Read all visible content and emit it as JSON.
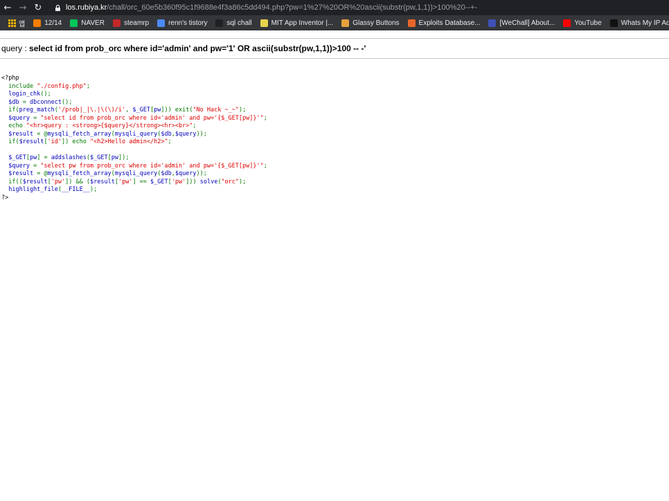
{
  "browser": {
    "url_host": "los.rubiya.kr",
    "url_path": "/chall/orc_60e5b360f95c1f9688e4f3a86c5dd494.php?pw=1%27%20OR%20ascii(substr(pw,1,1))>100%20--+-"
  },
  "bookmarks": [
    {
      "label": "앱",
      "icon": "apps-icon"
    },
    {
      "label": "12/14",
      "icon": "blogger-icon",
      "color": "#f57d00"
    },
    {
      "label": "NAVER",
      "icon": "naver-icon",
      "color": "#03c75a"
    },
    {
      "label": "steamrp",
      "icon": "steamrp-icon",
      "color": "#c62828"
    },
    {
      "label": "renn's tistory",
      "icon": "tistory-icon",
      "color": "#4c8bf5"
    },
    {
      "label": "sql chall",
      "icon": "z-icon",
      "color": "#202124"
    },
    {
      "label": "MIT App Inventor |...",
      "icon": "mit-icon",
      "color": "#e8d44d"
    },
    {
      "label": "Glassy Buttons",
      "icon": "glassy-icon",
      "color": "#e6a23c"
    },
    {
      "label": "Exploits Database...",
      "icon": "exploitdb-icon",
      "color": "#e8662a"
    },
    {
      "label": "[WeChall] About...",
      "icon": "wechall-icon",
      "color": "#3f51b5"
    },
    {
      "label": "YouTube",
      "icon": "youtube-icon",
      "color": "#ff0000"
    },
    {
      "label": "Whats My IP Ad",
      "icon": "whatsmyip-icon",
      "color": "#111111"
    }
  ],
  "page": {
    "query_prefix": "query : ",
    "query_sql": "select id from prob_orc where id='admin' and pw='1' OR ascii(substr(pw,1,1))>100 -- -'",
    "code_lines": [
      [
        {
          "t": "tag",
          "v": "<?php"
        }
      ],
      [
        {
          "t": "default",
          "v": "  "
        },
        {
          "t": "keyword",
          "v": "include "
        },
        {
          "t": "string",
          "v": "\"./config.php\""
        },
        {
          "t": "keyword",
          "v": ";"
        }
      ],
      [
        {
          "t": "default",
          "v": "  login_chk"
        },
        {
          "t": "keyword",
          "v": "();"
        }
      ],
      [
        {
          "t": "default",
          "v": "  $db "
        },
        {
          "t": "keyword",
          "v": "= "
        },
        {
          "t": "default",
          "v": "dbconnect"
        },
        {
          "t": "keyword",
          "v": "();"
        }
      ],
      [
        {
          "t": "default",
          "v": "  "
        },
        {
          "t": "keyword",
          "v": "if("
        },
        {
          "t": "default",
          "v": "preg_match"
        },
        {
          "t": "keyword",
          "v": "("
        },
        {
          "t": "string",
          "v": "'/prob|_|\\.|\\(\\)/i'"
        },
        {
          "t": "keyword",
          "v": ", "
        },
        {
          "t": "default",
          "v": "$_GET"
        },
        {
          "t": "keyword",
          "v": "["
        },
        {
          "t": "default",
          "v": "pw"
        },
        {
          "t": "keyword",
          "v": "])) exit("
        },
        {
          "t": "string",
          "v": "\"No Hack ~_~\""
        },
        {
          "t": "keyword",
          "v": ");"
        }
      ],
      [
        {
          "t": "default",
          "v": "  $query "
        },
        {
          "t": "keyword",
          "v": "= "
        },
        {
          "t": "string",
          "v": "\"select id from prob_orc where id='admin' and pw='{$_GET[pw]}'\""
        },
        {
          "t": "keyword",
          "v": ";"
        }
      ],
      [
        {
          "t": "default",
          "v": "  "
        },
        {
          "t": "keyword",
          "v": "echo "
        },
        {
          "t": "string",
          "v": "\"<hr>query : <strong>{$query}</strong><hr><br>\""
        },
        {
          "t": "keyword",
          "v": ";"
        }
      ],
      [
        {
          "t": "default",
          "v": "  $result "
        },
        {
          "t": "keyword",
          "v": "= @"
        },
        {
          "t": "default",
          "v": "mysqli_fetch_array"
        },
        {
          "t": "keyword",
          "v": "("
        },
        {
          "t": "default",
          "v": "mysqli_query"
        },
        {
          "t": "keyword",
          "v": "("
        },
        {
          "t": "default",
          "v": "$db"
        },
        {
          "t": "keyword",
          "v": ","
        },
        {
          "t": "default",
          "v": "$query"
        },
        {
          "t": "keyword",
          "v": "));"
        }
      ],
      [
        {
          "t": "default",
          "v": "  "
        },
        {
          "t": "keyword",
          "v": "if("
        },
        {
          "t": "default",
          "v": "$result"
        },
        {
          "t": "keyword",
          "v": "["
        },
        {
          "t": "string",
          "v": "'id'"
        },
        {
          "t": "keyword",
          "v": "]) echo "
        },
        {
          "t": "string",
          "v": "\"<h2>Hello admin</h2>\""
        },
        {
          "t": "keyword",
          "v": ";"
        }
      ],
      [
        {
          "t": "default",
          "v": ""
        }
      ],
      [
        {
          "t": "default",
          "v": "  $_GET"
        },
        {
          "t": "keyword",
          "v": "["
        },
        {
          "t": "default",
          "v": "pw"
        },
        {
          "t": "keyword",
          "v": "] = "
        },
        {
          "t": "default",
          "v": "addslashes"
        },
        {
          "t": "keyword",
          "v": "("
        },
        {
          "t": "default",
          "v": "$_GET"
        },
        {
          "t": "keyword",
          "v": "["
        },
        {
          "t": "default",
          "v": "pw"
        },
        {
          "t": "keyword",
          "v": "]);"
        }
      ],
      [
        {
          "t": "default",
          "v": "  $query "
        },
        {
          "t": "keyword",
          "v": "= "
        },
        {
          "t": "string",
          "v": "\"select pw from prob_orc where id='admin' and pw='{$_GET[pw]}'\""
        },
        {
          "t": "keyword",
          "v": ";"
        }
      ],
      [
        {
          "t": "default",
          "v": "  $result "
        },
        {
          "t": "keyword",
          "v": "= @"
        },
        {
          "t": "default",
          "v": "mysqli_fetch_array"
        },
        {
          "t": "keyword",
          "v": "("
        },
        {
          "t": "default",
          "v": "mysqli_query"
        },
        {
          "t": "keyword",
          "v": "("
        },
        {
          "t": "default",
          "v": "$db"
        },
        {
          "t": "keyword",
          "v": ","
        },
        {
          "t": "default",
          "v": "$query"
        },
        {
          "t": "keyword",
          "v": "));"
        }
      ],
      [
        {
          "t": "default",
          "v": "  "
        },
        {
          "t": "keyword",
          "v": "if(("
        },
        {
          "t": "default",
          "v": "$result"
        },
        {
          "t": "keyword",
          "v": "["
        },
        {
          "t": "string",
          "v": "'pw'"
        },
        {
          "t": "keyword",
          "v": "]) && ("
        },
        {
          "t": "default",
          "v": "$result"
        },
        {
          "t": "keyword",
          "v": "["
        },
        {
          "t": "string",
          "v": "'pw'"
        },
        {
          "t": "keyword",
          "v": "] == "
        },
        {
          "t": "default",
          "v": "$_GET"
        },
        {
          "t": "keyword",
          "v": "["
        },
        {
          "t": "string",
          "v": "'pw'"
        },
        {
          "t": "keyword",
          "v": "])) "
        },
        {
          "t": "default",
          "v": "solve"
        },
        {
          "t": "keyword",
          "v": "("
        },
        {
          "t": "string",
          "v": "\"orc\""
        },
        {
          "t": "keyword",
          "v": ");"
        }
      ],
      [
        {
          "t": "default",
          "v": "  highlight_file"
        },
        {
          "t": "keyword",
          "v": "("
        },
        {
          "t": "default",
          "v": "__FILE__"
        },
        {
          "t": "keyword",
          "v": ");"
        }
      ],
      [
        {
          "t": "tag",
          "v": "?>"
        }
      ]
    ]
  }
}
